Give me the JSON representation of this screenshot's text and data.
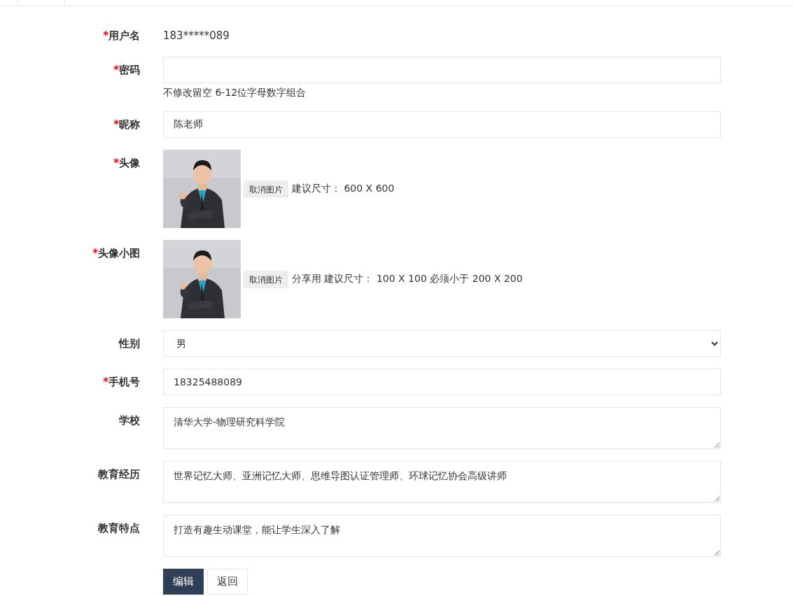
{
  "fields": [
    {
      "label": "用户名",
      "mark": "*",
      "kind": "text",
      "value": "183*****089"
    },
    {
      "label": "密码",
      "mark": "*",
      "kind": "password",
      "hint": "不修改留空 6-12位字母数字组合"
    },
    {
      "label": "昵称",
      "mark": "*",
      "kind": "input",
      "value": "陈老师"
    },
    {
      "label": "头像",
      "mark": "*",
      "button": "取消图片",
      "hint": "建议尺寸： 600 X 600"
    },
    {
      "label": "头像小图",
      "mark": "*",
      "button": "取消图片",
      "hint": "分享用 建议尺寸： 100 X 100 必须小于 200 X 200"
    },
    {
      "label": "性别",
      "kind": "select",
      "value": "男"
    },
    {
      "label": "手机号",
      "mark": "*",
      "kind": "input",
      "value": "18325488089"
    },
    {
      "label": "学校",
      "kind": "textarea",
      "value": "清华大学-物理研究科学院"
    },
    {
      "label": "教育经历",
      "kind": "textarea",
      "value": "世界记忆大师、亚洲记忆大师、思维导图认证管理师、环球记忆协会高级讲师"
    },
    {
      "label": "教育特点",
      "kind": "textarea",
      "value": "打造有趣生动课堂，能让学生深入了解"
    }
  ],
  "buttons": [
    {
      "label": "编辑",
      "primary": true
    },
    {
      "label": "返回",
      "primary": false
    }
  ]
}
